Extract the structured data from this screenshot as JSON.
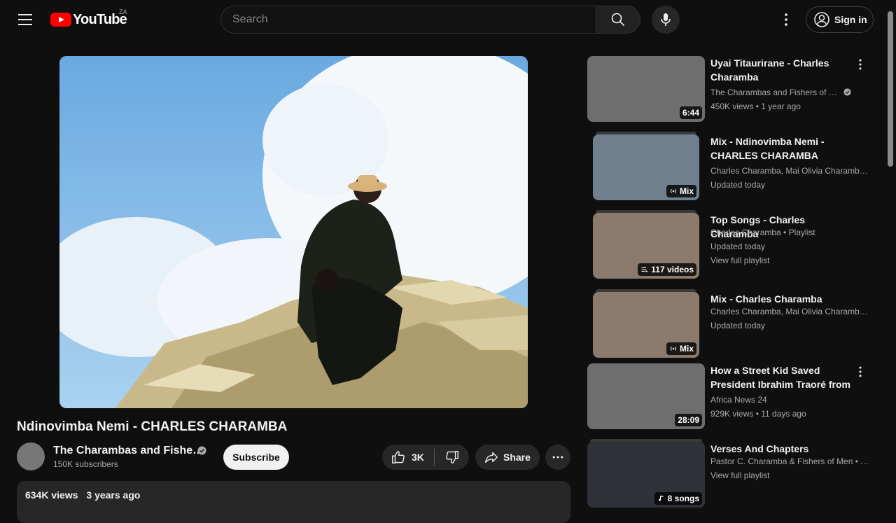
{
  "header": {
    "logo_text": "YouTube",
    "country_code": "ZA",
    "search_placeholder": "Search",
    "signin_label": "Sign in"
  },
  "video": {
    "title": "Ndinovimba Nemi - CHARLES CHARAMBA",
    "channel_name": "The Charambas and Fishe…",
    "subscribers": "150K subscribers",
    "subscribe_label": "Subscribe",
    "likes": "3K",
    "share_label": "Share",
    "views": "634K views",
    "age": "3 years ago"
  },
  "recommendations": [
    {
      "title": "Uyai Titaurirane - Charles Charamba",
      "line1": "The Charambas and Fishers of …",
      "line2": "450K views • 1 year ago",
      "line3": "",
      "badge": "6:44",
      "badge_icon": "",
      "thumb_color": "#6e6e6e",
      "stacked": false,
      "verified": true,
      "menu": true
    },
    {
      "title": "Mix - Ndinovimba Nemi - CHARLES CHARAMBA",
      "line1": "Charles Charamba, Mai Olivia Charamba,…",
      "line2": "Updated today",
      "line3": "",
      "badge": "Mix",
      "badge_icon": "mix-icon",
      "thumb_color": "#6f7f8d",
      "stacked": true,
      "verified": false,
      "menu": false
    },
    {
      "title": "Top Songs - Charles Charamba",
      "line1": "Charles Charamba • Playlist",
      "line2": "Updated today",
      "line3": "View full playlist",
      "badge": "117 videos",
      "badge_icon": "playlist-icon",
      "thumb_color": "#8c7a6c",
      "stacked": true,
      "verified": false,
      "menu": false
    },
    {
      "title": "Mix - Charles Charamba",
      "line1": "Charles Charamba, Mai Olivia Charamba,…",
      "line2": "Updated today",
      "line3": "",
      "badge": "Mix",
      "badge_icon": "mix-icon",
      "thumb_color": "#8c7a6c",
      "stacked": true,
      "verified": false,
      "menu": false
    },
    {
      "title": "How a Street Kid Saved President Ibrahim Traoré from …",
      "line1": "Africa News 24",
      "line2": "929K views • 11 days ago",
      "line3": "",
      "badge": "28:09",
      "badge_icon": "",
      "thumb_color": "#6e6e6e",
      "stacked": false,
      "verified": false,
      "menu": true
    },
    {
      "title": "Verses And Chapters",
      "line1": "Pastor C. Charamba & Fishers of Men • A…",
      "line2": "View full playlist",
      "line3": "",
      "badge": "8 songs",
      "badge_icon": "music-note-icon",
      "thumb_color": "#2f3338",
      "stacked": true,
      "verified": false,
      "menu": false
    }
  ],
  "colors": {
    "background": "#0f0f0f",
    "brand_red": "#ff0000",
    "chip_bg": "#272727",
    "secondary_text": "#aaaaaa"
  }
}
